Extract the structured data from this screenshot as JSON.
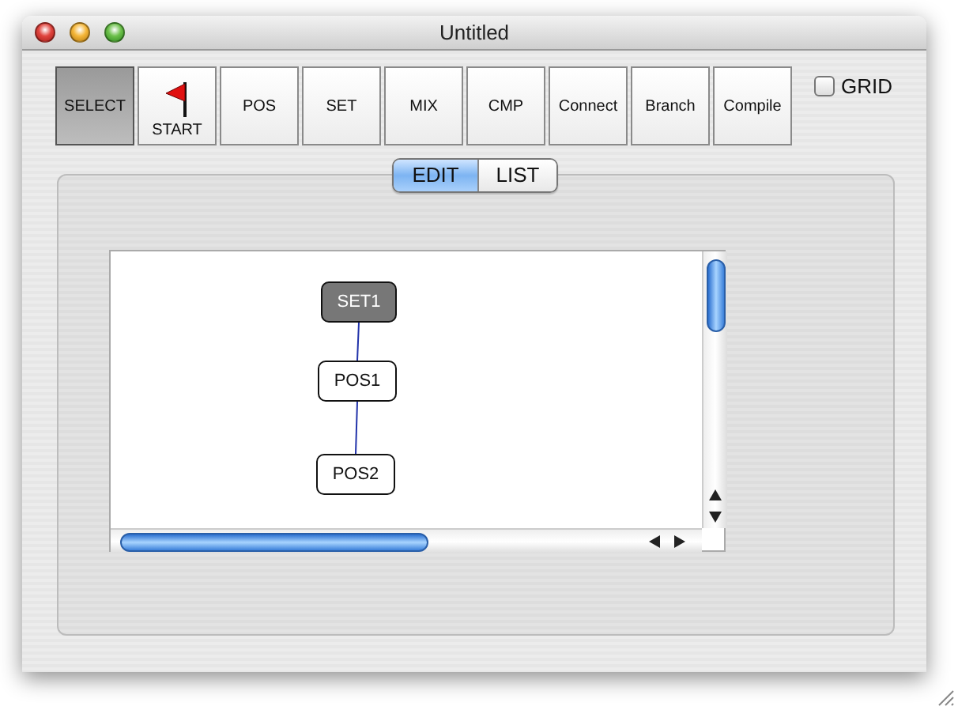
{
  "window": {
    "title": "Untitled"
  },
  "tools": [
    {
      "label": "SELECT",
      "kind": "text",
      "selected": true
    },
    {
      "label": "START",
      "kind": "flag",
      "selected": false
    },
    {
      "label": "POS",
      "kind": "text",
      "selected": false
    },
    {
      "label": "SET",
      "kind": "text",
      "selected": false
    },
    {
      "label": "MIX",
      "kind": "text",
      "selected": false
    },
    {
      "label": "CMP",
      "kind": "text",
      "selected": false
    },
    {
      "label": "Connect",
      "kind": "text",
      "selected": false
    },
    {
      "label": "Branch",
      "kind": "text",
      "selected": false
    },
    {
      "label": "Compile",
      "kind": "text",
      "selected": false
    }
  ],
  "grid": {
    "label": "GRID",
    "checked": false
  },
  "view_tabs": [
    {
      "label": "EDIT",
      "selected": true
    },
    {
      "label": "LIST",
      "selected": false
    }
  ],
  "diagram": {
    "nodes": [
      {
        "label": "SET1",
        "selected": true,
        "children": [
          {
            "label": "POS1",
            "selected": false,
            "children": [
              {
                "label": "POS2",
                "selected": false
              }
            ]
          }
        ]
      }
    ]
  }
}
